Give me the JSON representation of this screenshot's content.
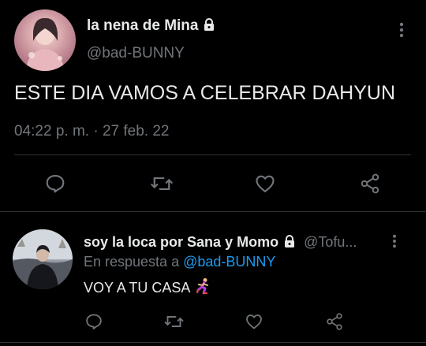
{
  "tweet": {
    "display_name": "la nena de Mina",
    "handle": "@bad-BUNNY",
    "text": "ESTE DIA VAMOS A CELEBRAR DAHYUN",
    "timestamp": "04:22 p. m. · 27 feb. 22",
    "avatar_icon": "profile-photo-pink",
    "lock_icon": "lock-icon",
    "actions": [
      "reply-icon",
      "retweet-icon",
      "like-icon",
      "share-icon"
    ]
  },
  "reply": {
    "display_name": "soy la loca por Sana y Momo",
    "handle": "@Tofu...",
    "reply_prefix": "En respuesta a",
    "reply_to": "@bad-BUNNY",
    "text": "VOY A TU CASA",
    "emoji": "running-person",
    "avatar_icon": "profile-photo-outdoor",
    "actions": [
      "reply-icon",
      "retweet-icon",
      "like-icon",
      "share-icon"
    ]
  },
  "colors": {
    "background": "#000000",
    "text": "#e7e9ea",
    "muted": "#71767b",
    "link": "#1d9bf0",
    "divider": "#2f3336"
  }
}
